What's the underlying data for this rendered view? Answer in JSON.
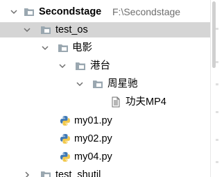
{
  "tree": {
    "root": {
      "label": "Secondstage",
      "path": "F:\\Secondstage"
    },
    "test_os": {
      "label": "test_os"
    },
    "movies": {
      "label": "电影"
    },
    "hongkong": {
      "label": "港台"
    },
    "zhouxingchi": {
      "label": "周星驰"
    },
    "kungfu_file": {
      "label": "功夫MP4"
    },
    "py_files": [
      {
        "label": "my01.py"
      },
      {
        "label": "my02.py"
      },
      {
        "label": "my04.py"
      }
    ],
    "test_shutil": {
      "label": "test_shutil"
    }
  },
  "colors": {
    "selection": "#d5d5d5",
    "folder": "#9aa7b0",
    "arrow": "#6e6e6e",
    "path_text": "#6e6e6e",
    "python_blue": "#3f79b5",
    "python_yellow": "#f2c84b"
  },
  "icons": {
    "folder": "folder-icon",
    "text_file": "text-file-icon",
    "python_file": "python-file-icon",
    "expand": "chevron-down-icon",
    "collapse": "chevron-right-icon"
  }
}
